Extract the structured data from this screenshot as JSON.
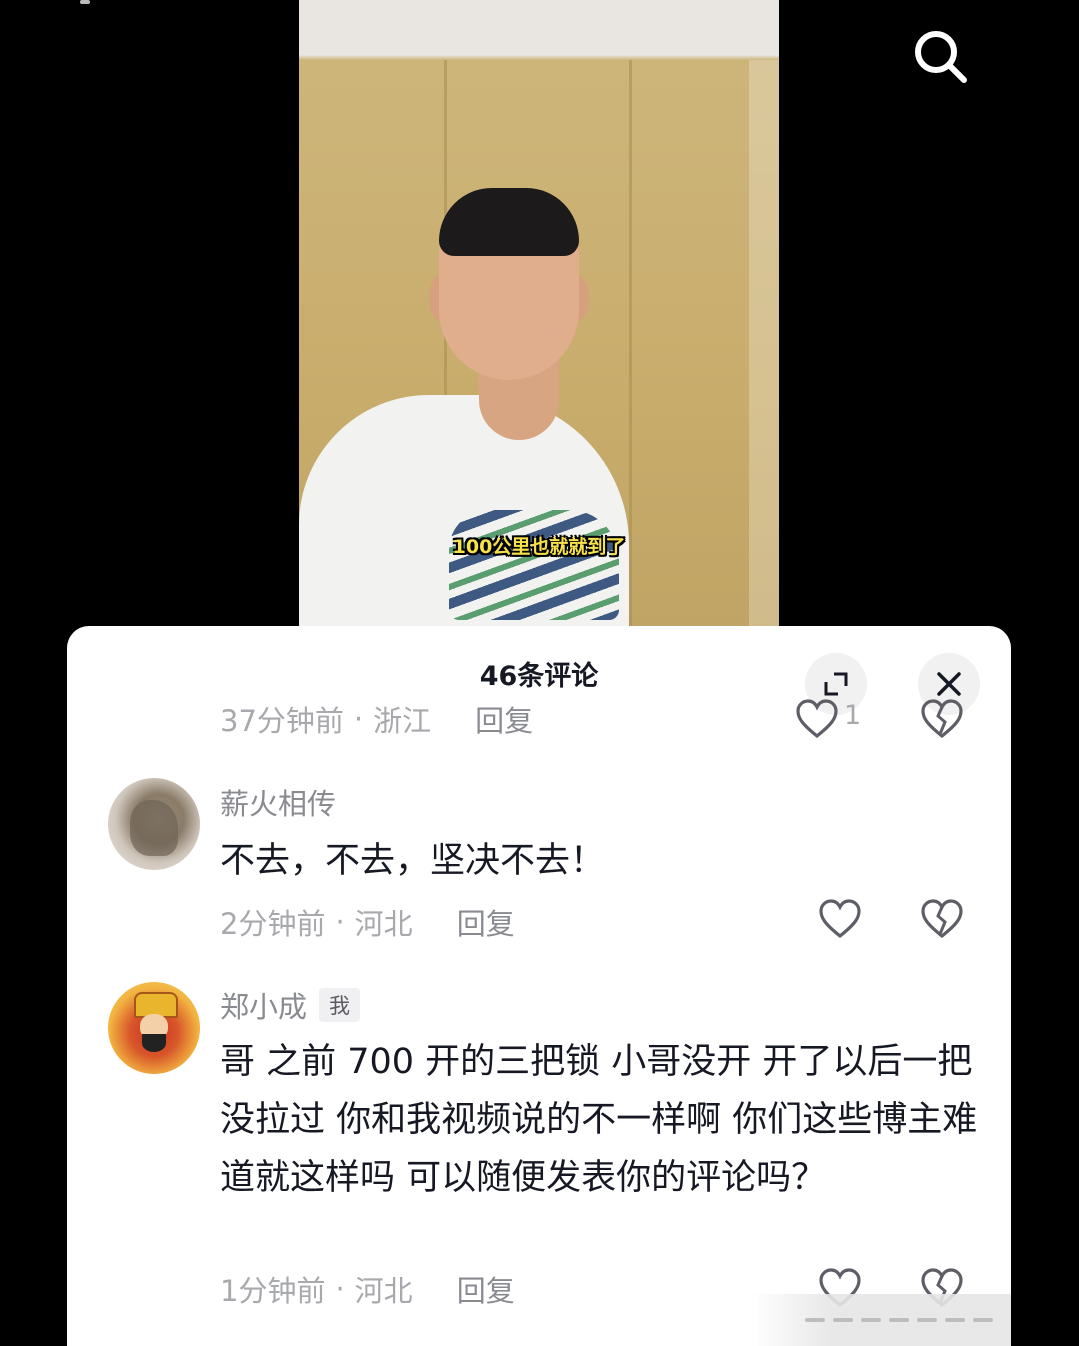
{
  "video": {
    "caption": "100公里也就就到了"
  },
  "icons": {
    "search": "search-icon",
    "expand": "expand-icon",
    "close": "close-icon",
    "like": "heart-icon",
    "dislike": "broken-heart-icon"
  },
  "sheet": {
    "title": "46条评论"
  },
  "comments": [
    {
      "time": "37分钟前",
      "separator": "·",
      "location": "浙江",
      "reply_label": "回复",
      "like_count": "1"
    },
    {
      "username": "薪火相传",
      "text": "不去，不去，坚决不去！",
      "time": "2分钟前",
      "separator": "·",
      "location": "河北",
      "reply_label": "回复"
    },
    {
      "username": "郑小成",
      "badge": "我",
      "text": "哥 之前 700 开的三把锁 小哥没开 开了以后一把没拉过 你和我视频说的不一样啊 你们这些博主难道就这样吗 可以随便发表你的评论吗？",
      "time": "1分钟前",
      "separator": "·",
      "location": "河北",
      "reply_label": "回复"
    }
  ],
  "colors": {
    "accent_text": "#161823",
    "meta_text": "#a8a9ad",
    "caption": "#f7e24a"
  }
}
